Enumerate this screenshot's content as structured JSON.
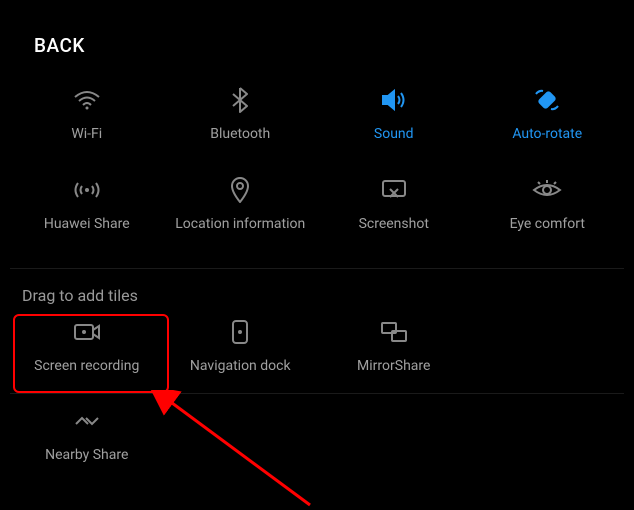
{
  "back": "BACK",
  "tiles": {
    "wifi": "Wi-Fi",
    "bluetooth": "Bluetooth",
    "sound": "Sound",
    "autorotate": "Auto-rotate",
    "huaweishare": "Huawei Share",
    "location": "Location information",
    "screenshot": "Screenshot",
    "eyecomfort": "Eye comfort",
    "screenrecord": "Screen recording",
    "navdock": "Navigation dock",
    "mirrorshare": "MirrorShare",
    "nearbyshare": "Nearby Share"
  },
  "section_title": "Drag to add tiles"
}
